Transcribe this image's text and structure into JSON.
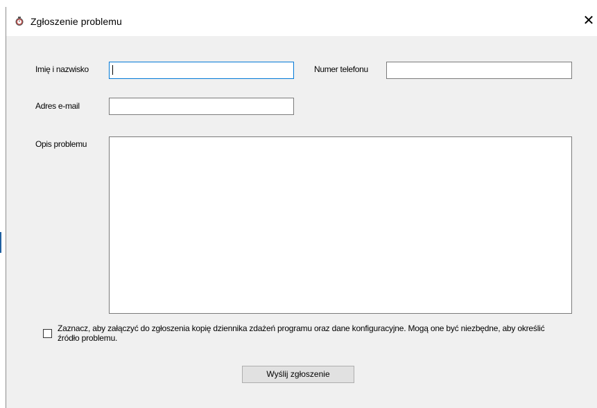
{
  "window": {
    "title": "Zgłoszenie problemu",
    "close_glyph": "✕",
    "app_icon": "stopwatch-icon"
  },
  "form": {
    "name_label": "Imię i nazwisko",
    "name_value": "",
    "phone_label": "Numer telefonu",
    "phone_value": "",
    "email_label": "Adres e-mail",
    "email_value": "",
    "description_label": "Opis problemu",
    "description_value": "",
    "attach_checkbox_checked": false,
    "attach_checkbox_text": "Zaznacz, aby załączyć do zgłoszenia kopię dziennika zdażeń programu oraz dane konfiguracyjne. Mogą one być niezbędne, aby określić źródło problemu.",
    "submit_label": "Wyślij zgłoszenie"
  },
  "colors": {
    "focus_border": "#0078d7",
    "dialog_bg": "#f0f0f0",
    "button_bg": "#e1e1e1"
  }
}
